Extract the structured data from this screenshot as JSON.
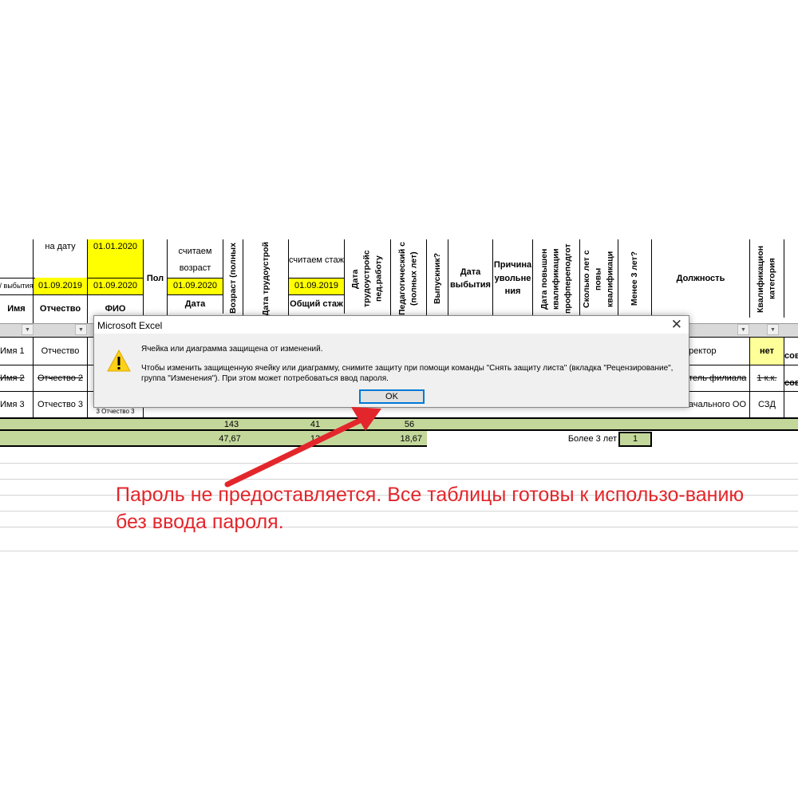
{
  "sheet": {
    "header_top": {
      "na_datu": "на дату",
      "date_2020_01": "01.01.2020",
      "pol": "Пол",
      "schitaem_vozrast": "считаем возраст",
      "vozrast": "Возраст (полных",
      "data_trud": "Дата трудоустрой",
      "schitaem_stazh": "считаем стаж",
      "data_trud_ped": "Дата трудоустройс пед.работу",
      "ped_stazh": "Педагогический с (полных лет)",
      "vypusknik": "Выпускник?",
      "data_vybytiya": "Дата выбытия",
      "prichina": "Причина увольне ния",
      "data_pov": "Дата повышен квалификации профпереподгот",
      "skolko_let": "Сколько лет с повы квалификаци",
      "menee3": "Менее 3 лет?",
      "dolzhnost": "Должность",
      "kval": "Квалификацион категория"
    },
    "date_row": {
      "vybytiya": "/ выбытия",
      "d1": "01.09.2019",
      "d2": "01.09.2020",
      "d3": "01.09.2020",
      "d4": "01.09.2019"
    },
    "col_headers": {
      "imya": "Имя",
      "otchestvo": "Отчество",
      "fio": "ФИО",
      "data": "Дата",
      "obshchiy_stazh": "Общий стаж"
    },
    "rows": [
      {
        "imya": "Имя 1",
        "otchestvo": "Отчество",
        "dolzhnost": "иректор",
        "kval": "нет",
        "extra": "совм",
        "strike": false
      },
      {
        "imya": "Имя 2",
        "otchestvo": "Отчество 2",
        "dolzhnost": "итель филиала",
        "kval": "1 к.к.",
        "extra": "совм",
        "strike": true
      },
      {
        "imya": "Имя 3",
        "otchestvo": "Отчество 3",
        "fio_small": "3 Отчество 3",
        "dolzhnost": "начального ОО",
        "kval": "СЗД",
        "extra": "",
        "strike": false
      }
    ],
    "totals": {
      "vozrast_sum": "143",
      "stazh_sum": "41",
      "ped_sum": "56",
      "vozrast_avg": "47,67",
      "stazh_avg": "13",
      "ped_avg": "18,67",
      "bolee3_label": "Более 3 лет",
      "bolee3_value": "1"
    }
  },
  "dialog": {
    "title": "Microsoft Excel",
    "message_line1": "Ячейка или диаграмма защищена от изменений.",
    "message_line2": "Чтобы изменить защищенную ячейку или диаграмму, снимите защиту при помощи команды \"Снять защиту листа\" (вкладка \"Рецензирование\", группа \"Изменения\"). При этом может потребоваться ввод пароля.",
    "ok_label": "OK",
    "icon": "warning-icon"
  },
  "annotation": {
    "text": "Пароль не предоставляется. Все таблицы готовы к использо-ванию без ввода пароля.",
    "color": "#e3262b"
  },
  "colors": {
    "yellow": "#ffff00",
    "green": "#c4d79b"
  }
}
